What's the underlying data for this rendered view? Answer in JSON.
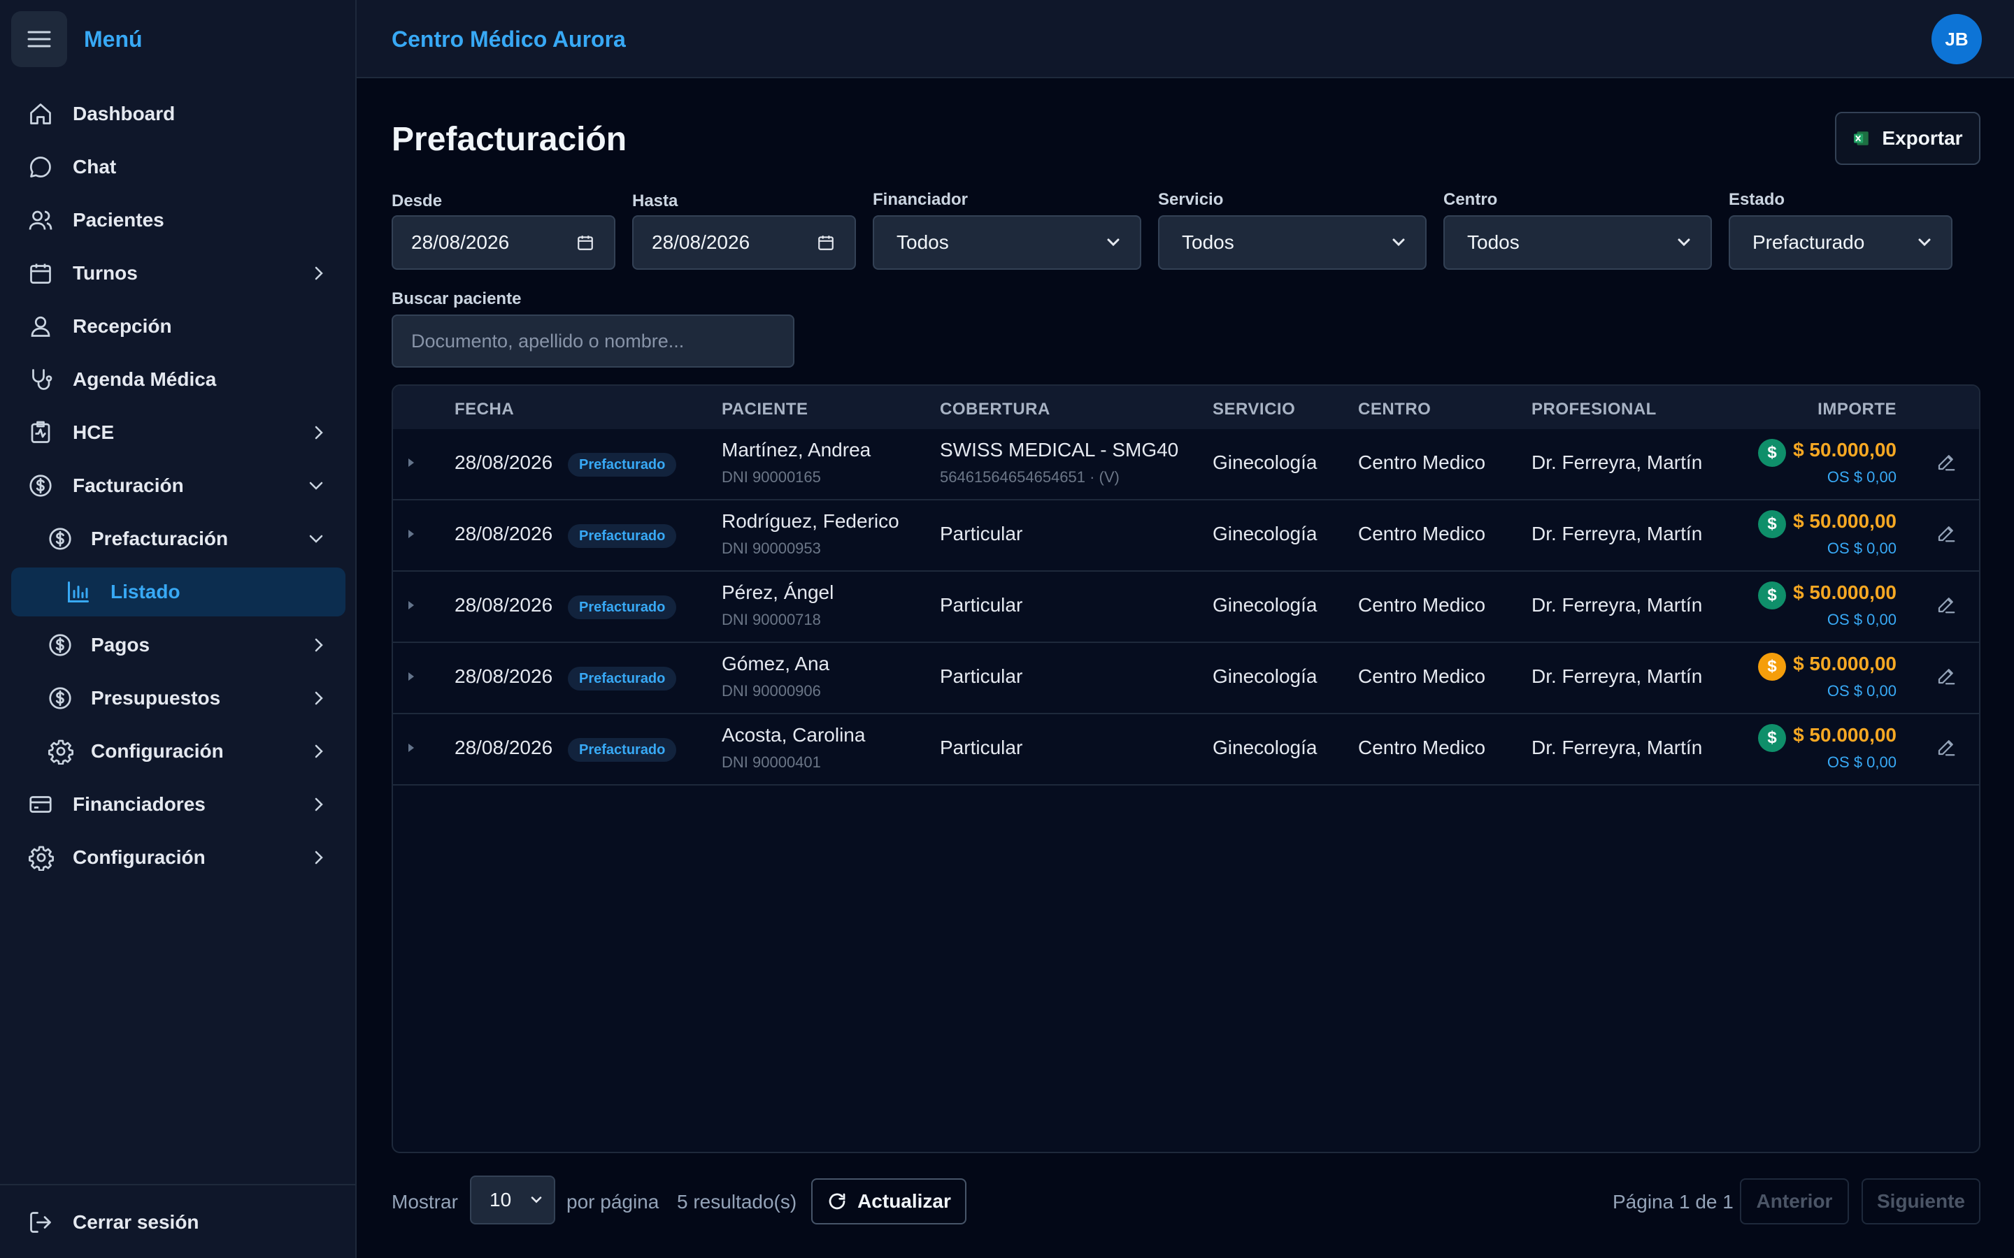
{
  "sidebar": {
    "title": "Menú",
    "items": [
      {
        "label": "Dashboard",
        "icon": "home-icon"
      },
      {
        "label": "Chat",
        "icon": "chat-icon"
      },
      {
        "label": "Pacientes",
        "icon": "users-icon"
      },
      {
        "label": "Turnos",
        "icon": "calendar-icon"
      },
      {
        "label": "Recepción",
        "icon": "user-icon"
      },
      {
        "label": "Agenda Médica",
        "icon": "stethoscope-icon"
      },
      {
        "label": "HCE",
        "icon": "clipboard-pulse-icon"
      },
      {
        "label": "Facturación",
        "icon": "dollar-circle-icon"
      },
      {
        "label": "Prefacturación",
        "icon": "dollar-circle-icon"
      },
      {
        "label": "Listado",
        "icon": "bar-chart-icon"
      },
      {
        "label": "Pagos",
        "icon": "dollar-circle-icon"
      },
      {
        "label": "Presupuestos",
        "icon": "dollar-circle-icon"
      },
      {
        "label": "Configuración",
        "icon": "gear-icon"
      },
      {
        "label": "Financiadores",
        "icon": "credit-card-icon"
      },
      {
        "label": "Configuración",
        "icon": "gear-icon"
      }
    ],
    "logout": "Cerrar sesión"
  },
  "header": {
    "brand": "Centro Médico Aurora",
    "avatar_initials": "JB"
  },
  "page": {
    "title": "Prefacturación",
    "export_label": "Exportar"
  },
  "filters": {
    "desde": {
      "label": "Desde",
      "value": "28/08/2026"
    },
    "hasta": {
      "label": "Hasta",
      "value": "28/08/2026"
    },
    "financiador": {
      "label": "Financiador",
      "value": "Todos"
    },
    "servicio": {
      "label": "Servicio",
      "value": "Todos"
    },
    "centro": {
      "label": "Centro",
      "value": "Todos"
    },
    "estado": {
      "label": "Estado",
      "value": "Prefacturado"
    },
    "search": {
      "label": "Buscar paciente",
      "placeholder": "Documento, apellido o nombre..."
    }
  },
  "table": {
    "columns": [
      "FECHA",
      "PACIENTE",
      "COBERTURA",
      "SERVICIO",
      "CENTRO",
      "PROFESIONAL",
      "IMPORTE"
    ],
    "rows": [
      {
        "fecha": "28/08/2026",
        "estado": "Prefacturado",
        "paciente": "Martínez, Andrea",
        "dni": "DNI 90000165",
        "cobertura": "SWISS MEDICAL - SMG40",
        "cobertura_sub": "56461564654654651 · (V)",
        "servicio": "Ginecología",
        "centro": "Centro Medico",
        "profesional": "Dr. Ferreyra, Martín",
        "importe": "$ 50.000,00",
        "os": "OS $ 0,00",
        "coin_color": "#0f8f6a"
      },
      {
        "fecha": "28/08/2026",
        "estado": "Prefacturado",
        "paciente": "Rodríguez, Federico",
        "dni": "DNI 90000953",
        "cobertura": "Particular",
        "cobertura_sub": "",
        "servicio": "Ginecología",
        "centro": "Centro Medico",
        "profesional": "Dr. Ferreyra, Martín",
        "importe": "$ 50.000,00",
        "os": "OS $ 0,00",
        "coin_color": "#0f8f6a"
      },
      {
        "fecha": "28/08/2026",
        "estado": "Prefacturado",
        "paciente": "Pérez, Ángel",
        "dni": "DNI 90000718",
        "cobertura": "Particular",
        "cobertura_sub": "",
        "servicio": "Ginecología",
        "centro": "Centro Medico",
        "profesional": "Dr. Ferreyra, Martín",
        "importe": "$ 50.000,00",
        "os": "OS $ 0,00",
        "coin_color": "#0f8f6a"
      },
      {
        "fecha": "28/08/2026",
        "estado": "Prefacturado",
        "paciente": "Gómez, Ana",
        "dni": "DNI 90000906",
        "cobertura": "Particular",
        "cobertura_sub": "",
        "servicio": "Ginecología",
        "centro": "Centro Medico",
        "profesional": "Dr. Ferreyra, Martín",
        "importe": "$ 50.000,00",
        "os": "OS $ 0,00",
        "coin_color": "#f59e0b"
      },
      {
        "fecha": "28/08/2026",
        "estado": "Prefacturado",
        "paciente": "Acosta, Carolina",
        "dni": "DNI 90000401",
        "cobertura": "Particular",
        "cobertura_sub": "",
        "servicio": "Ginecología",
        "centro": "Centro Medico",
        "profesional": "Dr. Ferreyra, Martín",
        "importe": "$ 50.000,00",
        "os": "OS $ 0,00",
        "coin_color": "#0f8f6a"
      }
    ]
  },
  "footer": {
    "mostrar": "Mostrar",
    "per_page": "10",
    "por_pagina": "por página",
    "resultados": "5 resultado(s)",
    "refresh": "Actualizar",
    "page_info": "Página 1 de 1",
    "prev": "Anterior",
    "next": "Siguiente"
  },
  "colors": {
    "accent": "#38a9f5",
    "amount": "#f6a823",
    "background": "#030817",
    "panel": "#0f172a"
  }
}
